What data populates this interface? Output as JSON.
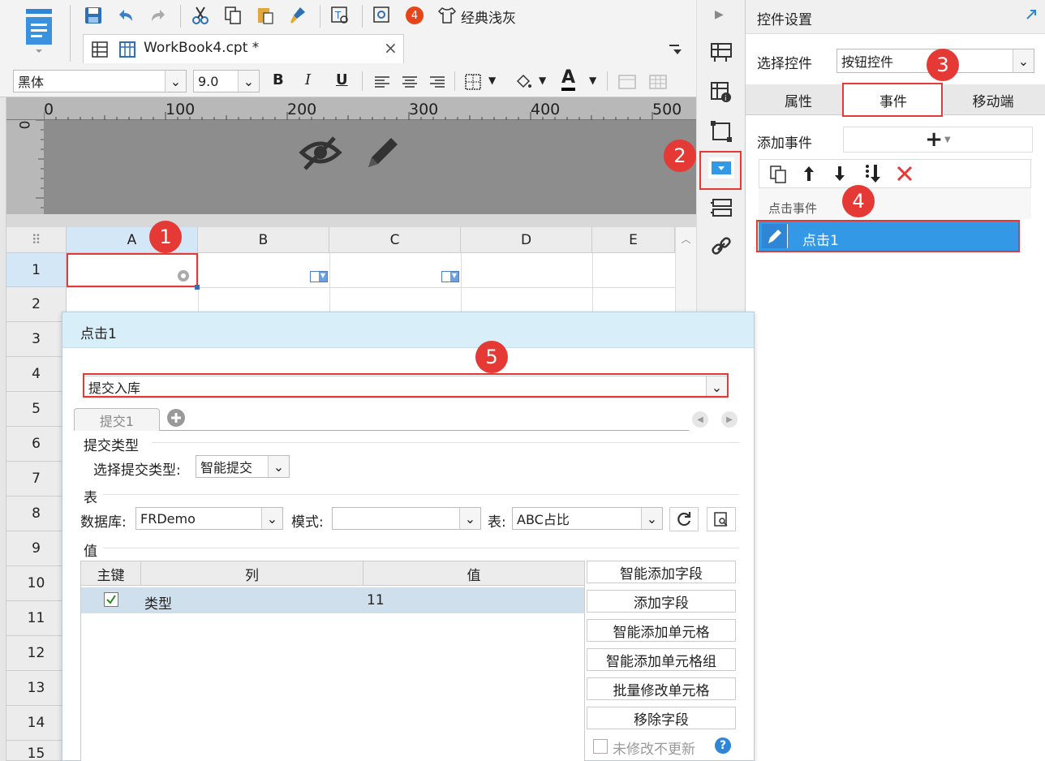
{
  "toolbar": {
    "theme_label": "经典浅灰",
    "notification_count": "4",
    "font_name": "黑体",
    "font_size": "9.0",
    "bold": "B",
    "italic": "I",
    "underline": "U",
    "font_color": "A"
  },
  "tab": {
    "label": "WorkBook4.cpt *",
    "close": "×"
  },
  "ruler": {
    "ticks": [
      "0",
      "100",
      "200",
      "300",
      "400",
      "500"
    ],
    "vertical_zero": "0"
  },
  "grid": {
    "columns": [
      "A",
      "B",
      "C",
      "D",
      "E"
    ],
    "rows": [
      "1",
      "2",
      "3",
      "4",
      "5",
      "6",
      "7",
      "8",
      "9",
      "10",
      "11",
      "12",
      "13",
      "14",
      "15"
    ]
  },
  "badges": [
    "1",
    "2",
    "3",
    "4",
    "5"
  ],
  "right_panel": {
    "title": "控件设置",
    "select_label": "选择控件",
    "select_value": "按钮控件",
    "tabs": [
      "属性",
      "事件",
      "移动端"
    ],
    "add_event_label": "添加事件",
    "add_event_button": "+",
    "event_group": "点击事件",
    "event_item": "点击1"
  },
  "dialog": {
    "title": "点击1",
    "action_value": "提交入库",
    "subtab": "提交1",
    "submit_type_section": "提交类型",
    "submit_type_label": "选择提交类型:",
    "submit_type_value": "智能提交",
    "table_section": "表",
    "db_label": "数据库:",
    "db_value": "FRDemo",
    "schema_label": "模式:",
    "schema_value": "",
    "table_label": "表:",
    "table_value": "ABC占比",
    "value_section": "值",
    "table_headers": [
      "主键",
      "列",
      "值"
    ],
    "table_rows": [
      {
        "column": "类型",
        "value": "11"
      }
    ],
    "buttons": [
      "智能添加字段",
      "添加字段",
      "智能添加单元格",
      "智能添加单元格组",
      "批量修改单元格",
      "移除字段"
    ],
    "no_update_label": "未修改不更新",
    "help": "?"
  },
  "colors": {
    "accent": "#3399e6",
    "highlight_red": "#e53935",
    "dialog_header": "#d8eef9"
  }
}
